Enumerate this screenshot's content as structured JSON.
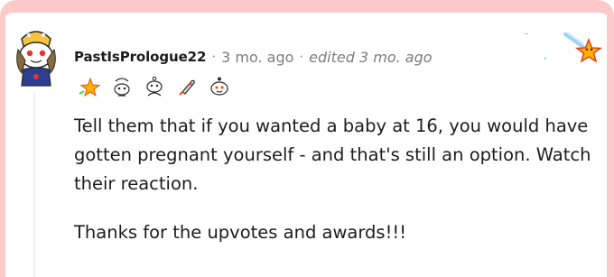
{
  "comment": {
    "username": "PastIsPrologue22",
    "separator": "·",
    "time_ago": "3 mo. ago",
    "edited_label": "edited 3 mo. ago",
    "awards": [
      {
        "icon": "rocket-star-award-icon"
      },
      {
        "icon": "snoo-spin-award-icon"
      },
      {
        "icon": "snoo-thinking-award-icon"
      },
      {
        "icon": "rocket-like-award-icon"
      },
      {
        "icon": "snoo-face-award-icon"
      }
    ],
    "body": {
      "paragraph_1": "Tell them that if you wanted a baby at 16, you would have gotten pregnant yourself - and that's still an option. Watch their reaction.",
      "paragraph_2": "Thanks for the upvotes and awards!!!"
    }
  },
  "colors": {
    "frame_border": "#ffc9c9",
    "username": "#1c1c1c",
    "meta_text": "#7c7c7c",
    "body_text": "#1c1c1c",
    "thread_line": "#edeff1",
    "award_star": "#ffb000"
  }
}
